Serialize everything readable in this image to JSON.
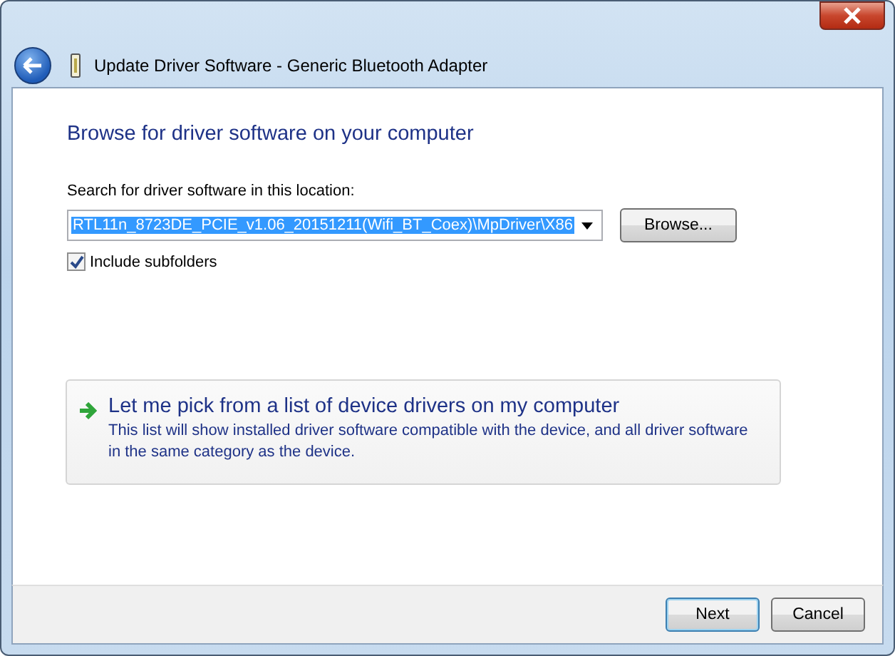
{
  "window": {
    "title": "Update Driver Software - Generic Bluetooth Adapter"
  },
  "heading": "Browse for driver software on your computer",
  "location": {
    "label": "Search for driver software in this location:",
    "value": "RTL11n_8723DE_PCIE_v1.06_20151211(Wifi_BT_Coex)\\MpDriver\\X86",
    "browse": "Browse..."
  },
  "include_subfolders": {
    "label": "Include subfolders",
    "checked": true
  },
  "pick_option": {
    "title": "Let me pick from a list of device drivers on my computer",
    "description": "This list will show installed driver software compatible with the device, and all driver software in the same category as the device."
  },
  "buttons": [
    {
      "label": "Next",
      "kind": "default"
    },
    {
      "label": "Cancel",
      "kind": "normal"
    }
  ]
}
